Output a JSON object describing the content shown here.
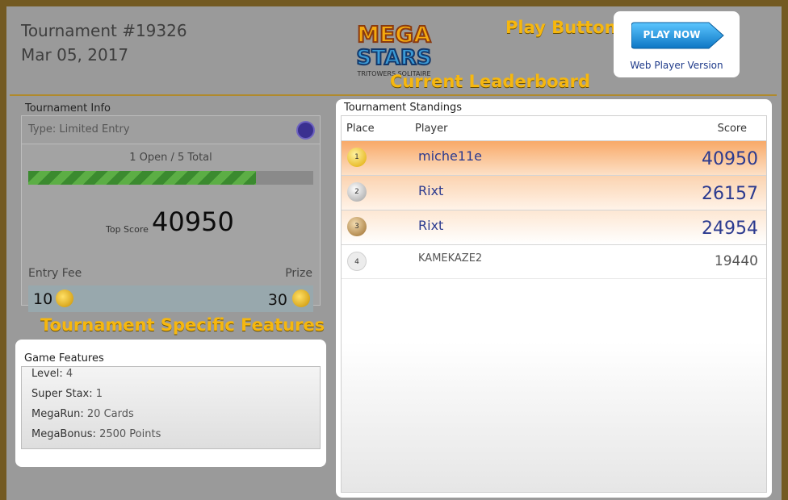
{
  "header": {
    "tournament_title": "Tournament #19326",
    "date": "Mar 05, 2017"
  },
  "logo": {
    "line1": "MEGA",
    "line2": "STARS",
    "tagline": "TRITOWERS SOLITAIRE"
  },
  "annotations": {
    "play_button": "Play Button",
    "current_leaderboard": "Current Leaderboard",
    "tournament_features": "Tournament Specific Features"
  },
  "play": {
    "button_label": "PLAY NOW",
    "web_player": "Web Player Version"
  },
  "tournament_info": {
    "section_label": "Tournament Info",
    "type": "Type: Limited Entry",
    "open_text": "1 Open / 5 Total",
    "progress_fraction": 0.8,
    "top_score_label": "Top Score",
    "top_score_value": "40950",
    "entry_fee_label": "Entry Fee",
    "prize_label": "Prize",
    "entry_fee_value": "10",
    "prize_value": "30"
  },
  "game_features": {
    "section_label": "Game Features",
    "items": [
      {
        "name": "Level:",
        "value": "4"
      },
      {
        "name": "Super Stax:",
        "value": "1"
      },
      {
        "name": "MegaRun:",
        "value": "20 Cards"
      },
      {
        "name": "MegaBonus:",
        "value": "2500 Points"
      }
    ]
  },
  "standings": {
    "section_label": "Tournament Standings",
    "col_place": "Place",
    "col_player": "Player",
    "col_score": "Score",
    "rows": [
      {
        "place": "1",
        "player": "miche11e",
        "score": "40950"
      },
      {
        "place": "2",
        "player": "Rixt",
        "score": "26157"
      },
      {
        "place": "3",
        "player": "Rixt",
        "score": "24954"
      },
      {
        "place": "4",
        "player": "KAMEKAZE2",
        "score": "19440"
      }
    ]
  },
  "colors": {
    "accent": "#f6b70f",
    "play_button": "#1b8fd8",
    "progress": "#4a9d3a",
    "score_text": "#2b3a8f"
  }
}
